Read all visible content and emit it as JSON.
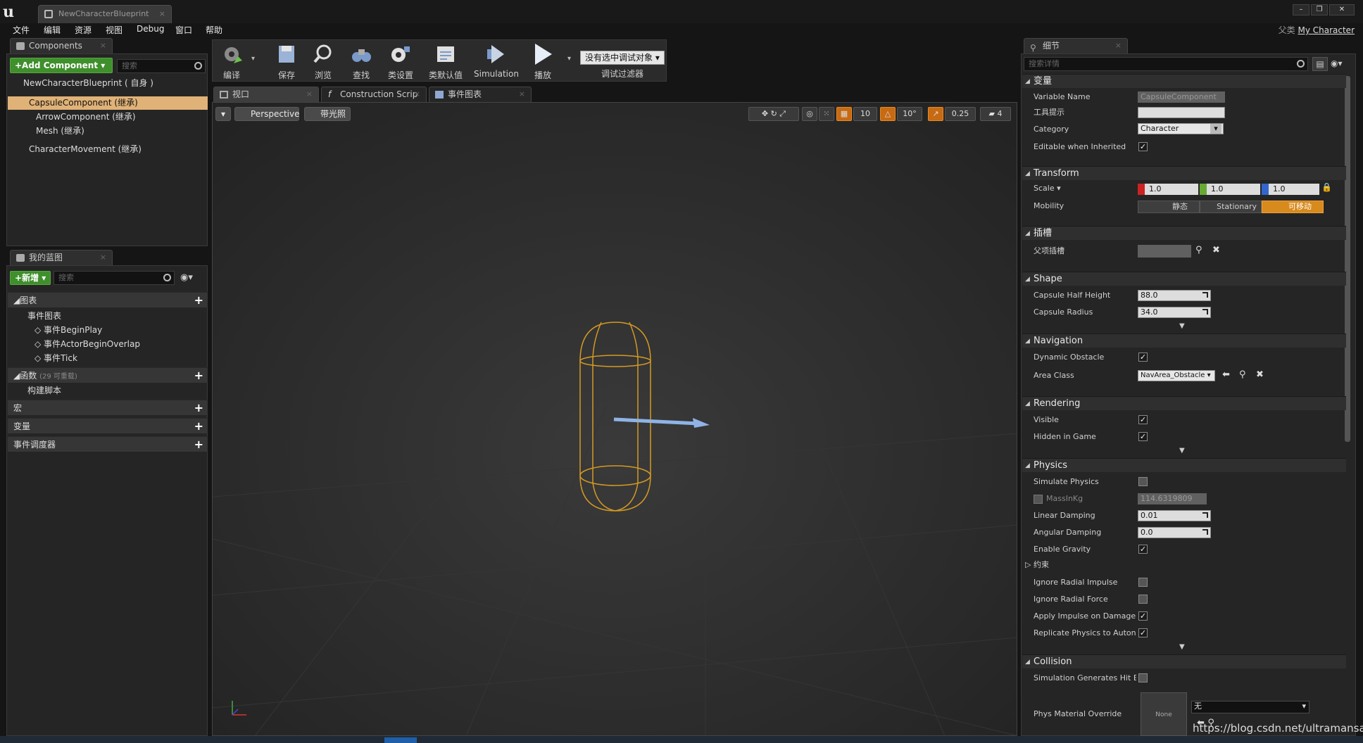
{
  "window": {
    "tab_title": "NewCharacterBlueprint",
    "parent_class_label": "父类",
    "parent_class_value": "My Character"
  },
  "menu": [
    "文件",
    "编辑",
    "资源",
    "视图",
    "Debug",
    "窗口",
    "帮助"
  ],
  "components": {
    "tab_label": "Components",
    "add_label": "+Add Component",
    "search_placeholder": "搜索",
    "root_label": "NewCharacterBlueprint ( 自身 )",
    "items": [
      "CapsuleComponent (继承)",
      "ArrowComponent (继承)",
      "Mesh (继承)",
      "CharacterMovement (继承)"
    ]
  },
  "myblueprint": {
    "tab_label": "我的蓝图",
    "new_label": "新增",
    "search_placeholder": "搜索",
    "graphs_label": "图表",
    "event_graph_label": "事件图表",
    "events": [
      "事件BeginPlay",
      "事件ActorBeginOverlap",
      "事件Tick"
    ],
    "functions_label": "函数",
    "functions_sub": "(29 可重载)",
    "construction_label": "构建脚本",
    "macros_label": "宏",
    "variables_label": "变量",
    "dispatchers_label": "事件调度器"
  },
  "toolbar": {
    "compile": "编译",
    "save": "保存",
    "browse": "浏览",
    "find": "查找",
    "class_settings": "类设置",
    "class_defaults": "类默认值",
    "simulation": "Simulation",
    "play": "播放",
    "debug_select": "没有选中调试对象",
    "debug_filter": "调试过滤器"
  },
  "viewport": {
    "tabs": [
      "视口",
      "Construction Scrip",
      "事件图表"
    ],
    "perspective": "Perspective",
    "lit": "带光照",
    "grid_snap": "10",
    "rot_snap": "10°",
    "scale_snap": "0.25",
    "cam_speed": "4"
  },
  "details": {
    "tab_label": "细节",
    "search_placeholder": "搜索详情",
    "variable": {
      "header": "变量",
      "name_label": "Variable Name",
      "name_value": "CapsuleComponent",
      "tooltip_label": "工具提示",
      "category_label": "Category",
      "category_value": "Character",
      "editable_label": "Editable when Inherited"
    },
    "transform": {
      "header": "Transform",
      "scale_label": "Scale",
      "x": "1.0",
      "y": "1.0",
      "z": "1.0",
      "mobility_label": "Mobility",
      "static": "静态",
      "stationary": "Stationary",
      "movable": "可移动"
    },
    "socket": {
      "header": "插槽",
      "parent_label": "父项插槽"
    },
    "shape": {
      "header": "Shape",
      "half_height_label": "Capsule Half Height",
      "half_height": "88.0",
      "radius_label": "Capsule Radius",
      "radius": "34.0"
    },
    "navigation": {
      "header": "Navigation",
      "dyn_label": "Dynamic Obstacle",
      "area_label": "Area Class",
      "area_value": "NavArea_Obstacle"
    },
    "rendering": {
      "header": "Rendering",
      "visible_label": "Visible",
      "hidden_label": "Hidden in Game"
    },
    "physics": {
      "header": "Physics",
      "simulate": "Simulate Physics",
      "mass_label": "MassInKg",
      "mass": "114.6319809",
      "lin_label": "Linear Damping",
      "lin": "0.01",
      "ang_label": "Angular Damping",
      "ang": "0.0",
      "gravity": "Enable Gravity",
      "constraints": "约束",
      "irad_imp": "Ignore Radial Impulse",
      "irad_force": "Ignore Radial Force",
      "impulse_dmg": "Apply Impulse on Damage",
      "replicate": "Replicate Physics to Autonom"
    },
    "collision": {
      "header": "Collision",
      "sim_hit": "Simulation Generates Hit Eve",
      "phys_mat": "Phys Material Override",
      "none": "None",
      "none_cn": "无"
    }
  },
  "watermark": "https://blog.csdn.net/ultramansail"
}
